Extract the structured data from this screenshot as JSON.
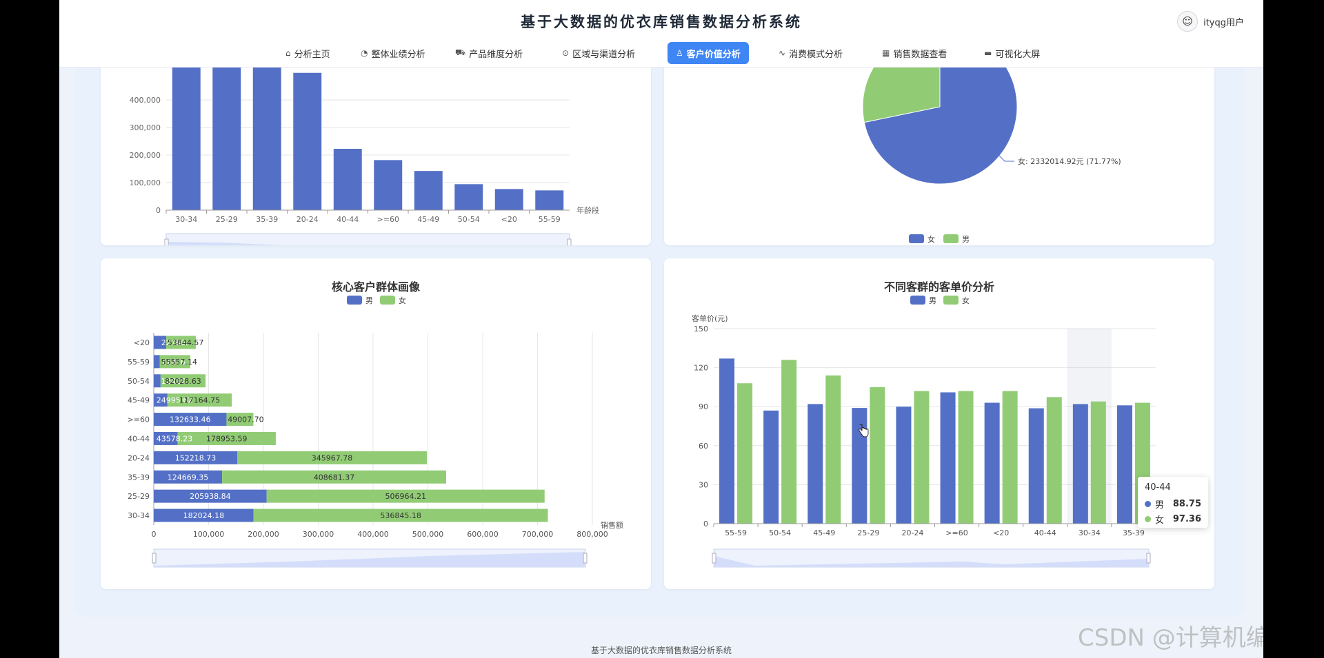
{
  "header": {
    "title": "基于大数据的优衣库销售数据分析系统",
    "user_name": "ityqg用户"
  },
  "nav": [
    {
      "label": "分析主页",
      "icon": "home-icon",
      "glyph": "⌂"
    },
    {
      "label": "整体业绩分析",
      "icon": "speedometer-icon",
      "glyph": "◔"
    },
    {
      "label": "产品维度分析",
      "icon": "cart-icon",
      "glyph": "⛟"
    },
    {
      "label": "区域与渠道分析",
      "icon": "location-pin-icon",
      "glyph": "⊙"
    },
    {
      "label": "客户价值分析",
      "icon": "user-icon",
      "glyph": "♙",
      "active": true
    },
    {
      "label": "消费模式分析",
      "icon": "pulse-icon",
      "glyph": "∿"
    },
    {
      "label": "销售数据查看",
      "icon": "table-icon",
      "glyph": "▦"
    },
    {
      "label": "可视化大屏",
      "icon": "monitor-icon",
      "glyph": "▬"
    }
  ],
  "colors": {
    "male": "#5470c6",
    "female": "#91cc75",
    "accent": "#3f86f5"
  },
  "charts": {
    "age_sales": {
      "type": "bar",
      "categories": [
        "30-34",
        "25-29",
        "35-39",
        "20-24",
        "40-44",
        ">=60",
        "45-49",
        "50-54",
        "<20",
        "55-59"
      ],
      "values": [
        718870,
        712903,
        533351,
        498186,
        222532,
        181641,
        142160,
        94246,
        76611,
        71622
      ],
      "xlabel": "年龄段",
      "ylim": [
        0,
        400000
      ],
      "yticks": [
        "0",
        "100,000",
        "200,000",
        "300,000",
        "400,000"
      ]
    },
    "gender_pie": {
      "type": "pie",
      "slices": [
        {
          "name": "女",
          "value": 71.77,
          "color": "#5470c6"
        },
        {
          "name": "男",
          "value": 28.23,
          "color": "#91cc75"
        }
      ],
      "label": "女: 2332014.92元 (71.77%)",
      "legend": [
        "女",
        "男"
      ]
    },
    "core_profile": {
      "type": "bar",
      "title": "核心客户群体画像",
      "legend": [
        "男",
        "女"
      ],
      "categories": [
        "<20",
        "55-59",
        "50-54",
        "45-49",
        ">=60",
        "40-44",
        "20-24",
        "35-39",
        "25-29",
        "30-34"
      ],
      "series": [
        {
          "name": "男",
          "values": [
            22766.0,
            11056.0,
            12417.0,
            24995.62,
            132633.46,
            43578.23,
            152218.73,
            124669.35,
            205938.84,
            182024.18
          ]
        },
        {
          "name": "女",
          "values": [
            53844.57,
            55567.14,
            82028.63,
            117164.75,
            49007.7,
            178953.59,
            345967.78,
            408681.37,
            506964.21,
            536845.18
          ]
        }
      ],
      "male_labels": [
        "22766.",
        "11056.",
        "12417.",
        "24995.62",
        "132633.46",
        "43578.23",
        "152218.73",
        "124669.35",
        "205938.84",
        "182024.18"
      ],
      "female_labels": [
        "53844.57",
        "55557.14",
        "82028.63",
        "117164.75",
        "49007.70",
        "178953.59",
        "345967.78",
        "408681.37",
        "506964.21",
        "536845.18"
      ],
      "xlabel": "销售额",
      "xlim": [
        0,
        800000
      ],
      "xticks": [
        "0",
        "100,000",
        "200,000",
        "300,000",
        "400,000",
        "500,000",
        "600,000",
        "700,000",
        "800,000"
      ]
    },
    "unit_price": {
      "type": "bar",
      "title": "不同客群的客单价分析",
      "legend": [
        "男",
        "女"
      ],
      "ylabel": "客单价(元)",
      "xlabel": "年龄段",
      "categories": [
        "55-59",
        "50-54",
        "45-49",
        "25-29",
        "20-24",
        ">=60",
        "<20",
        "40-44",
        "30-34",
        "35-39"
      ],
      "series": [
        {
          "name": "男",
          "values": [
            127,
            87,
            92,
            89,
            90,
            101,
            93,
            88.75,
            92,
            91
          ]
        },
        {
          "name": "女",
          "values": [
            108,
            126,
            114,
            105,
            102,
            102,
            102,
            97.36,
            94,
            93
          ]
        }
      ],
      "ylim": [
        0,
        150
      ],
      "yticks": [
        "0",
        "30",
        "60",
        "90",
        "120",
        "150"
      ]
    }
  },
  "tooltip": {
    "title": "40-44",
    "rows": [
      {
        "name": "男",
        "value": "88.75"
      },
      {
        "name": "女",
        "value": "97.36"
      }
    ]
  },
  "footer": "基于大数据的优衣库销售数据分析系统",
  "watermark": "CSDN @计算机编程果茶熊"
}
